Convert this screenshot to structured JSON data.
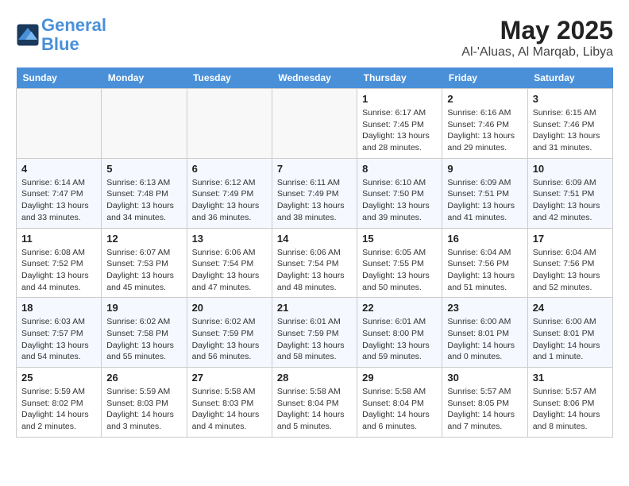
{
  "header": {
    "logo_line1": "General",
    "logo_line2": "Blue",
    "month": "May 2025",
    "location": "Al-'Aluas, Al Marqab, Libya"
  },
  "weekdays": [
    "Sunday",
    "Monday",
    "Tuesday",
    "Wednesday",
    "Thursday",
    "Friday",
    "Saturday"
  ],
  "weeks": [
    [
      {
        "day": "",
        "detail": ""
      },
      {
        "day": "",
        "detail": ""
      },
      {
        "day": "",
        "detail": ""
      },
      {
        "day": "",
        "detail": ""
      },
      {
        "day": "1",
        "detail": "Sunrise: 6:17 AM\nSunset: 7:45 PM\nDaylight: 13 hours\nand 28 minutes."
      },
      {
        "day": "2",
        "detail": "Sunrise: 6:16 AM\nSunset: 7:46 PM\nDaylight: 13 hours\nand 29 minutes."
      },
      {
        "day": "3",
        "detail": "Sunrise: 6:15 AM\nSunset: 7:46 PM\nDaylight: 13 hours\nand 31 minutes."
      }
    ],
    [
      {
        "day": "4",
        "detail": "Sunrise: 6:14 AM\nSunset: 7:47 PM\nDaylight: 13 hours\nand 33 minutes."
      },
      {
        "day": "5",
        "detail": "Sunrise: 6:13 AM\nSunset: 7:48 PM\nDaylight: 13 hours\nand 34 minutes."
      },
      {
        "day": "6",
        "detail": "Sunrise: 6:12 AM\nSunset: 7:49 PM\nDaylight: 13 hours\nand 36 minutes."
      },
      {
        "day": "7",
        "detail": "Sunrise: 6:11 AM\nSunset: 7:49 PM\nDaylight: 13 hours\nand 38 minutes."
      },
      {
        "day": "8",
        "detail": "Sunrise: 6:10 AM\nSunset: 7:50 PM\nDaylight: 13 hours\nand 39 minutes."
      },
      {
        "day": "9",
        "detail": "Sunrise: 6:09 AM\nSunset: 7:51 PM\nDaylight: 13 hours\nand 41 minutes."
      },
      {
        "day": "10",
        "detail": "Sunrise: 6:09 AM\nSunset: 7:51 PM\nDaylight: 13 hours\nand 42 minutes."
      }
    ],
    [
      {
        "day": "11",
        "detail": "Sunrise: 6:08 AM\nSunset: 7:52 PM\nDaylight: 13 hours\nand 44 minutes."
      },
      {
        "day": "12",
        "detail": "Sunrise: 6:07 AM\nSunset: 7:53 PM\nDaylight: 13 hours\nand 45 minutes."
      },
      {
        "day": "13",
        "detail": "Sunrise: 6:06 AM\nSunset: 7:54 PM\nDaylight: 13 hours\nand 47 minutes."
      },
      {
        "day": "14",
        "detail": "Sunrise: 6:06 AM\nSunset: 7:54 PM\nDaylight: 13 hours\nand 48 minutes."
      },
      {
        "day": "15",
        "detail": "Sunrise: 6:05 AM\nSunset: 7:55 PM\nDaylight: 13 hours\nand 50 minutes."
      },
      {
        "day": "16",
        "detail": "Sunrise: 6:04 AM\nSunset: 7:56 PM\nDaylight: 13 hours\nand 51 minutes."
      },
      {
        "day": "17",
        "detail": "Sunrise: 6:04 AM\nSunset: 7:56 PM\nDaylight: 13 hours\nand 52 minutes."
      }
    ],
    [
      {
        "day": "18",
        "detail": "Sunrise: 6:03 AM\nSunset: 7:57 PM\nDaylight: 13 hours\nand 54 minutes."
      },
      {
        "day": "19",
        "detail": "Sunrise: 6:02 AM\nSunset: 7:58 PM\nDaylight: 13 hours\nand 55 minutes."
      },
      {
        "day": "20",
        "detail": "Sunrise: 6:02 AM\nSunset: 7:59 PM\nDaylight: 13 hours\nand 56 minutes."
      },
      {
        "day": "21",
        "detail": "Sunrise: 6:01 AM\nSunset: 7:59 PM\nDaylight: 13 hours\nand 58 minutes."
      },
      {
        "day": "22",
        "detail": "Sunrise: 6:01 AM\nSunset: 8:00 PM\nDaylight: 13 hours\nand 59 minutes."
      },
      {
        "day": "23",
        "detail": "Sunrise: 6:00 AM\nSunset: 8:01 PM\nDaylight: 14 hours\nand 0 minutes."
      },
      {
        "day": "24",
        "detail": "Sunrise: 6:00 AM\nSunset: 8:01 PM\nDaylight: 14 hours\nand 1 minute."
      }
    ],
    [
      {
        "day": "25",
        "detail": "Sunrise: 5:59 AM\nSunset: 8:02 PM\nDaylight: 14 hours\nand 2 minutes."
      },
      {
        "day": "26",
        "detail": "Sunrise: 5:59 AM\nSunset: 8:03 PM\nDaylight: 14 hours\nand 3 minutes."
      },
      {
        "day": "27",
        "detail": "Sunrise: 5:58 AM\nSunset: 8:03 PM\nDaylight: 14 hours\nand 4 minutes."
      },
      {
        "day": "28",
        "detail": "Sunrise: 5:58 AM\nSunset: 8:04 PM\nDaylight: 14 hours\nand 5 minutes."
      },
      {
        "day": "29",
        "detail": "Sunrise: 5:58 AM\nSunset: 8:04 PM\nDaylight: 14 hours\nand 6 minutes."
      },
      {
        "day": "30",
        "detail": "Sunrise: 5:57 AM\nSunset: 8:05 PM\nDaylight: 14 hours\nand 7 minutes."
      },
      {
        "day": "31",
        "detail": "Sunrise: 5:57 AM\nSunset: 8:06 PM\nDaylight: 14 hours\nand 8 minutes."
      }
    ]
  ]
}
